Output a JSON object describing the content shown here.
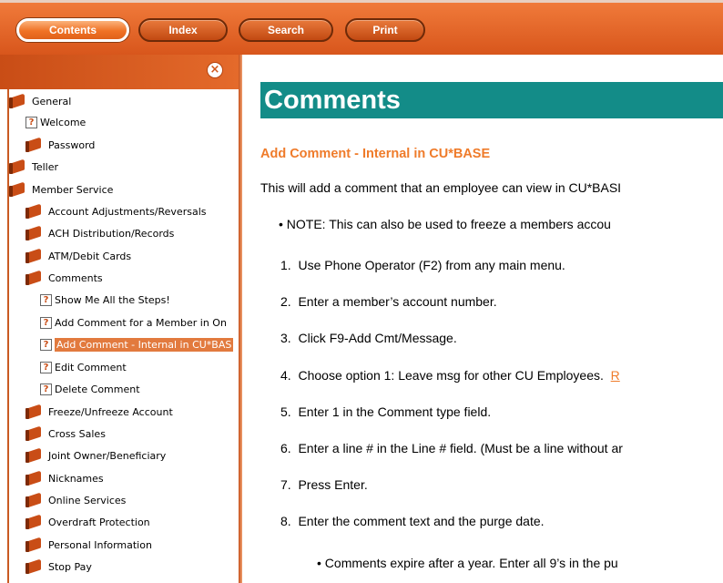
{
  "toolbar": {
    "buttons": [
      {
        "label": "Contents"
      },
      {
        "label": "Index"
      },
      {
        "label": "Search"
      },
      {
        "label": "Print"
      }
    ]
  },
  "sidebar": {
    "close_glyph": "×",
    "items": [
      {
        "label": "General",
        "icon": "book-icon"
      },
      {
        "label": "Welcome",
        "icon": "help-icon"
      },
      {
        "label": "Password",
        "icon": "book-icon"
      },
      {
        "label": "Teller",
        "icon": "book-icon"
      },
      {
        "label": "Member Service",
        "icon": "book-icon"
      },
      {
        "label": "Account Adjustments/Reversals",
        "icon": "book-icon"
      },
      {
        "label": "ACH Distribution/Records",
        "icon": "book-icon"
      },
      {
        "label": "ATM/Debit Cards",
        "icon": "book-icon"
      },
      {
        "label": "Comments",
        "icon": "book-icon"
      },
      {
        "label": "Show Me All the Steps!",
        "icon": "help-icon"
      },
      {
        "label": "Add Comment for a Member in On",
        "icon": "help-icon"
      },
      {
        "label": "Add Comment - Internal in CU*BAS",
        "icon": "help-icon",
        "selected": true
      },
      {
        "label": "Edit Comment",
        "icon": "help-icon"
      },
      {
        "label": "Delete Comment",
        "icon": "help-icon"
      },
      {
        "label": "Freeze/Unfreeze Account",
        "icon": "book-icon"
      },
      {
        "label": "Cross Sales",
        "icon": "book-icon"
      },
      {
        "label": "Joint Owner/Beneficiary",
        "icon": "book-icon"
      },
      {
        "label": "Nicknames",
        "icon": "book-icon"
      },
      {
        "label": "Online Services",
        "icon": "book-icon"
      },
      {
        "label": "Overdraft Protection",
        "icon": "book-icon"
      },
      {
        "label": "Personal Information",
        "icon": "book-icon"
      },
      {
        "label": "Stop Pay",
        "icon": "book-icon"
      }
    ]
  },
  "content": {
    "title": "Comments",
    "subheading": "Add Comment - Internal in CU*BASE",
    "intro": "This will add a comment that an employee can view in CU*BASI",
    "note": "•  NOTE:  This can also be used to freeze a members accou",
    "steps": [
      {
        "number": "1.",
        "text": "Use Phone Operator (F2) from any main menu."
      },
      {
        "number": "2.",
        "text": "Enter a member’s account number."
      },
      {
        "number": "3.",
        "text": "Click F9-Add Cmt/Message."
      },
      {
        "number": "4.",
        "text": "Choose option 1:  Leave msg for other CU Employees.",
        "link": "R"
      },
      {
        "number": "5.",
        "text": "Enter 1 in the Comment type field."
      },
      {
        "number": "6.",
        "text": "Enter a line # in the Line # field.  (Must be a line without ar"
      },
      {
        "number": "7.",
        "text": "Press Enter."
      },
      {
        "number": "8.",
        "text": "Enter the comment text and the purge date."
      }
    ],
    "sub_note": "•  Comments expire after a year.  Enter all 9’s in the pu"
  },
  "colors": {
    "toolbar_orange": "#e2622a",
    "title_teal": "#138c88",
    "accent_orange": "#ef7b2a",
    "selection_orange": "#e27a3e"
  }
}
